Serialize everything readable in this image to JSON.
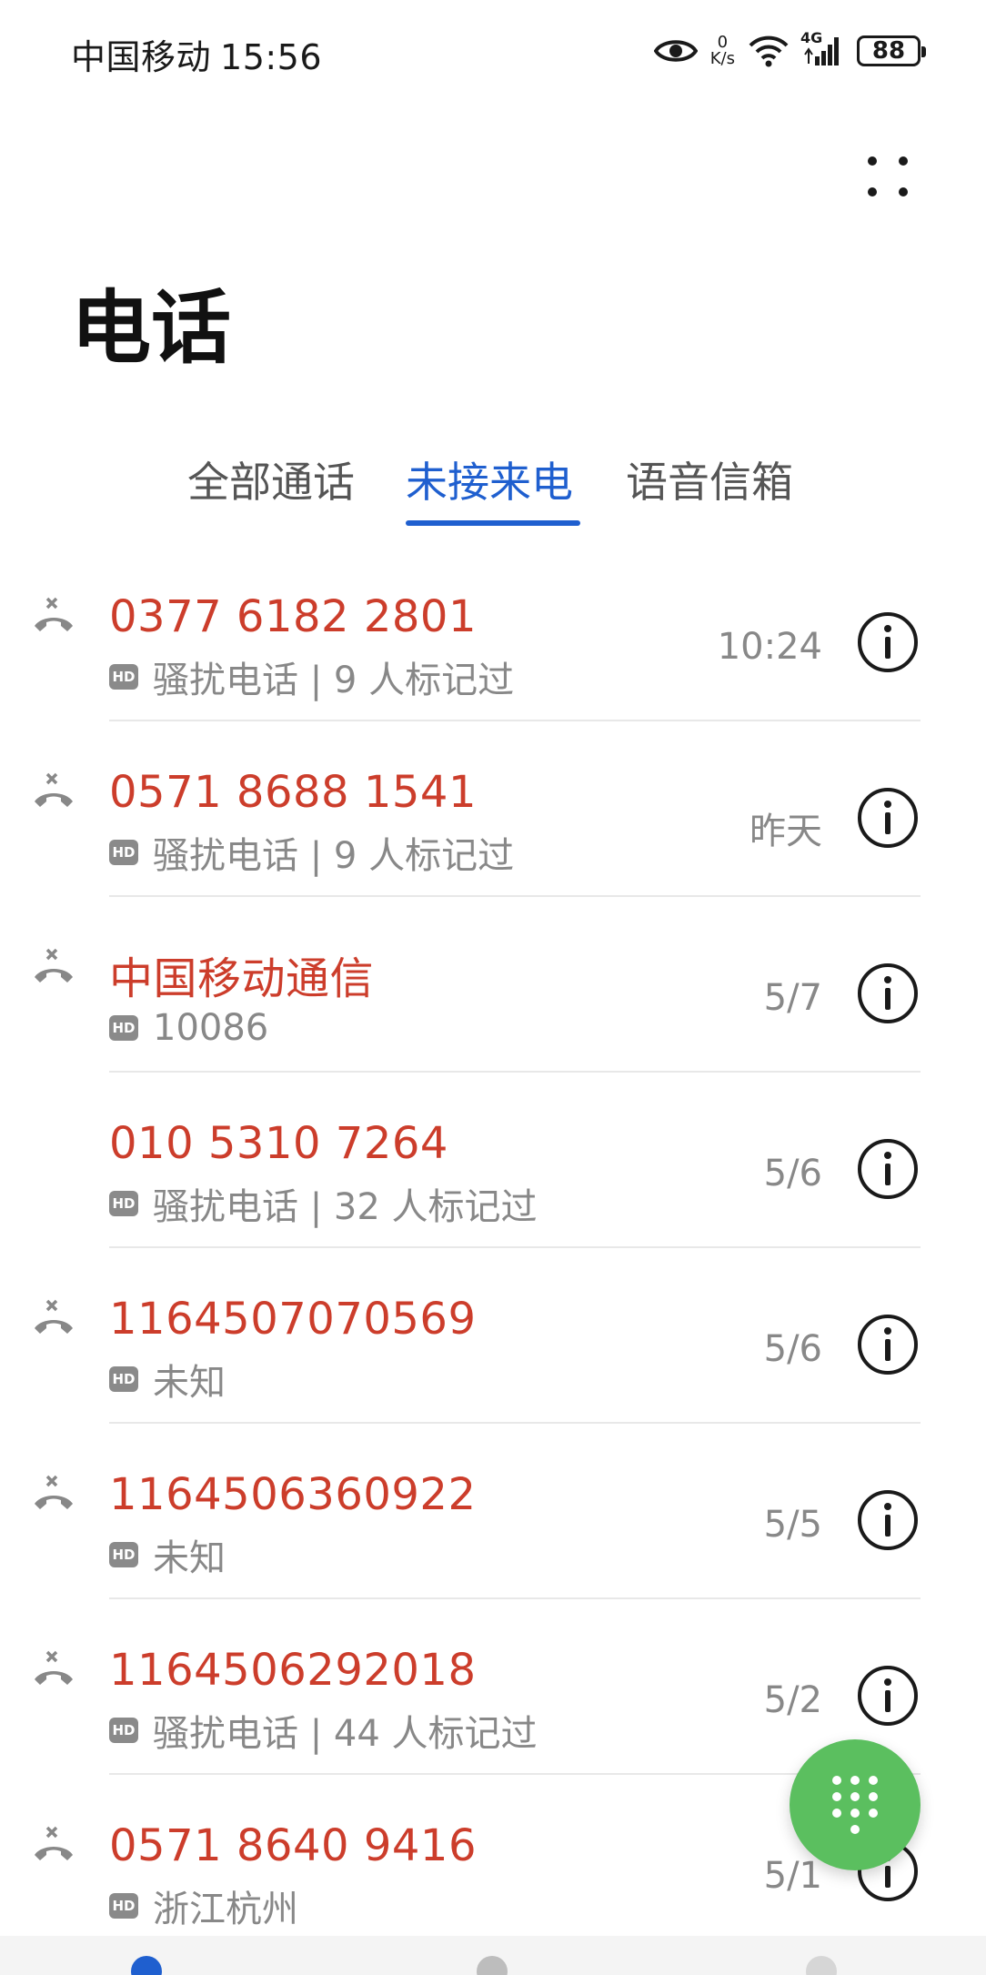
{
  "status_bar": {
    "carrier": "中国移动",
    "time": "15:56",
    "net_speed_value": "0",
    "net_speed_unit": "K/s",
    "network_type": "4G",
    "battery": "88"
  },
  "header": {
    "title": "电话",
    "more_icon": "more-dots-icon"
  },
  "tabs": [
    {
      "label": "全部通话",
      "active": false
    },
    {
      "label": "未接来电",
      "active": true
    },
    {
      "label": "语音信箱",
      "active": false
    }
  ],
  "calls": [
    {
      "name": "0377 6182 2801",
      "hd": "HD",
      "desc": "骚扰电话 | 9 人标记过",
      "time": "10:24",
      "missed_icon": true
    },
    {
      "name": "0571 8688 1541",
      "hd": "HD",
      "desc": "骚扰电话 | 9 人标记过",
      "time": "昨天",
      "missed_icon": true
    },
    {
      "name": "中国移动通信",
      "hd": "HD",
      "desc": "10086",
      "time": "5/7",
      "missed_icon": true
    },
    {
      "name": "010 5310 7264",
      "hd": "HD",
      "desc": "骚扰电话 | 32 人标记过",
      "time": "5/6",
      "missed_icon": false
    },
    {
      "name": "1164507070569",
      "hd": "HD",
      "desc": "未知",
      "time": "5/6",
      "missed_icon": true
    },
    {
      "name": "1164506360922",
      "hd": "HD",
      "desc": "未知",
      "time": "5/5",
      "missed_icon": true
    },
    {
      "name": "1164506292018",
      "hd": "HD",
      "desc": "骚扰电话 | 44 人标记过",
      "time": "5/2",
      "missed_icon": true
    },
    {
      "name": "0571 8640 9416",
      "hd": "HD",
      "desc": "浙江杭州",
      "time": "5/1",
      "missed_icon": true
    }
  ],
  "colors": {
    "accent": "#1f5fcf",
    "missed": "#cc3d2b",
    "fab": "#5bbf5f",
    "secondary_text": "#888888"
  },
  "fab": {
    "icon": "dialpad-icon"
  }
}
